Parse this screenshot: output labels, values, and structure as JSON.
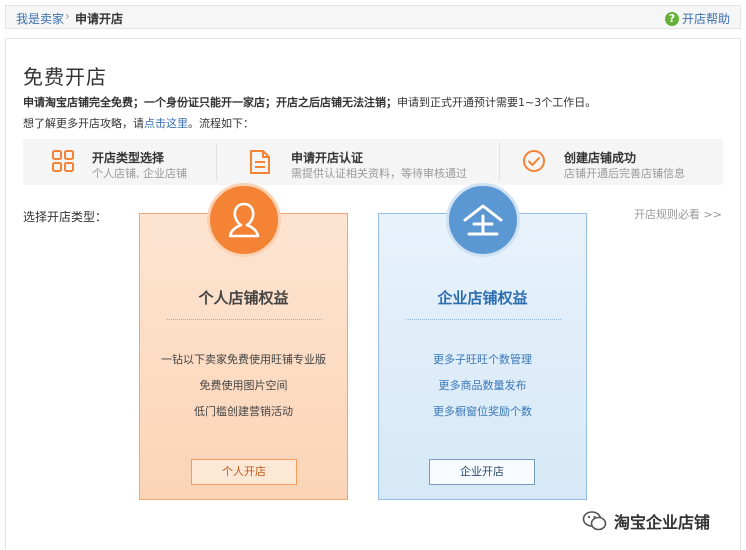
{
  "breadcrumb": {
    "root": "我是卖家",
    "separator": "›",
    "current": "申请开店"
  },
  "help": {
    "icon": "question-icon",
    "label": "开店帮助",
    "icon_glyph": "?"
  },
  "page": {
    "title": "免费开店",
    "notice_bold": "申请淘宝店铺完全免费；一个身份证只能开一家店；开店之后店铺无法注销；",
    "notice_rest": "申请到正式开通预计需要1~3个工作日。",
    "guide_prefix": "想了解更多开店攻略，请",
    "guide_link": "点击这里",
    "guide_suffix": "。流程如下："
  },
  "steps": [
    {
      "title": "开店类型选择",
      "desc": "个人店铺, 企业店铺",
      "icon": "grid-icon"
    },
    {
      "title": "申请开店认证",
      "desc": "需提供认证相关资料，等待审核通过",
      "icon": "document-icon"
    },
    {
      "title": "创建店铺成功",
      "desc": "店铺开通后完善店铺信息",
      "icon": "check-circle-icon"
    }
  ],
  "choose_label": "选择开店类型：",
  "rules_link": "开店规则必看 >>",
  "cards": {
    "personal": {
      "icon": "person-icon",
      "title": "个人店铺权益",
      "features": [
        "一钻以下卖家免费使用旺铺专业版",
        "免费使用图片空间",
        "低门槛创建营销活动"
      ],
      "button": "个人开店"
    },
    "enterprise": {
      "icon": "enterprise-icon",
      "title": "企业店铺权益",
      "features": [
        "更多子旺旺个数管理",
        "更多商品数量发布",
        "更多橱窗位奖励个数"
      ],
      "button": "企业开店"
    }
  },
  "watermark": {
    "icon": "wechat-icon",
    "text": "淘宝企业店铺"
  },
  "colors": {
    "link": "#3a6fb0",
    "orange": "#f48336",
    "blue": "#5b97d2",
    "green": "#65b23a"
  }
}
